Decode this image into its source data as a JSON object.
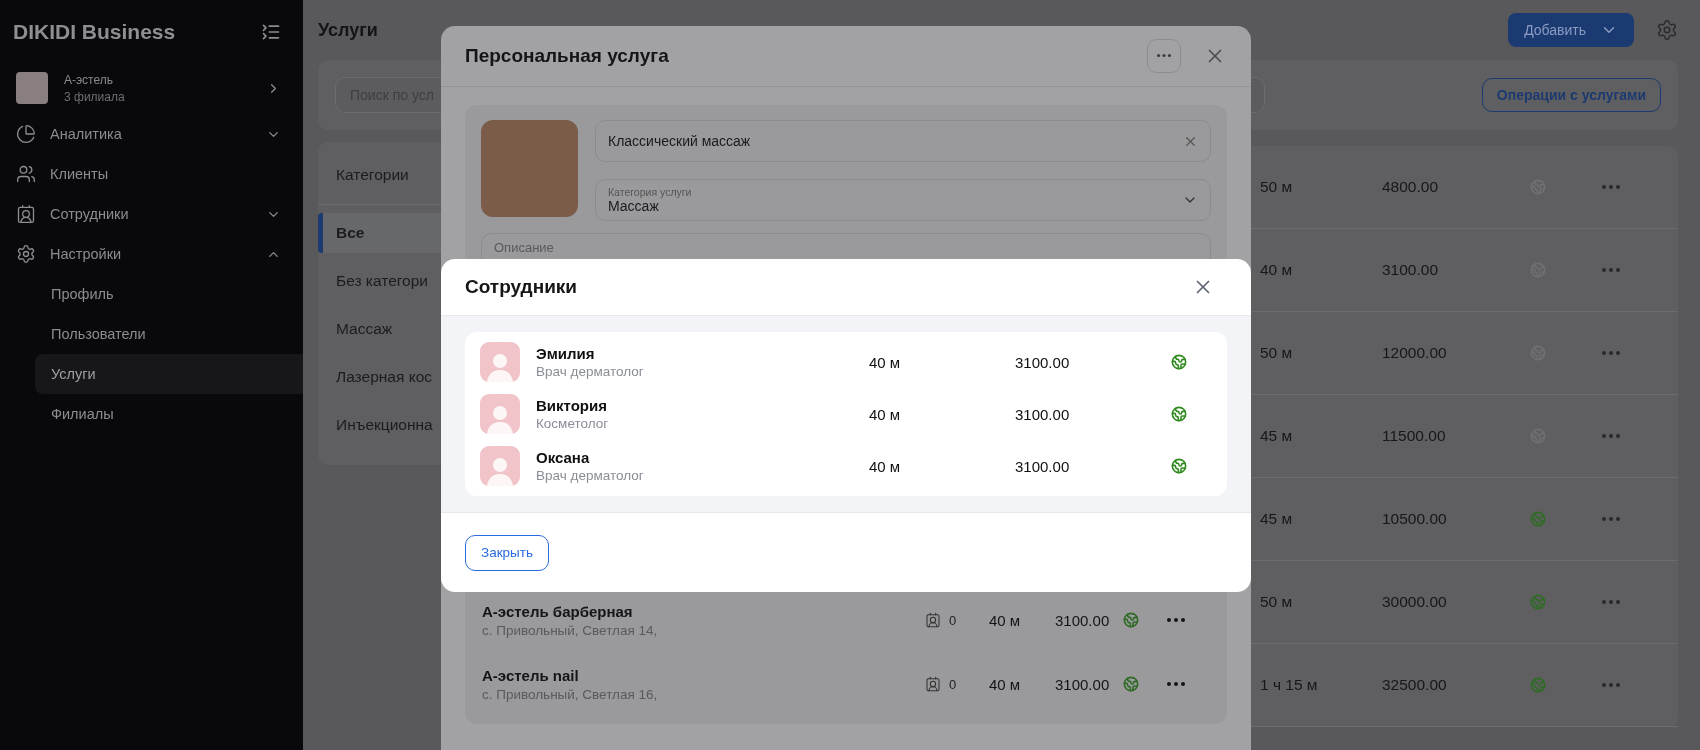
{
  "sidebar": {
    "brand": "DIKIDI Business",
    "account": {
      "name": "А-эстель",
      "subtitle": "3 филиала"
    },
    "items": [
      {
        "label": "Аналитика",
        "kind": "group",
        "expanded": false
      },
      {
        "label": "Клиенты",
        "kind": "link"
      },
      {
        "label": "Сотрудники",
        "kind": "group",
        "expanded": false
      },
      {
        "label": "Настройки",
        "kind": "group",
        "expanded": true,
        "children": [
          {
            "label": "Профиль",
            "selected": false
          },
          {
            "label": "Пользователи",
            "selected": false
          },
          {
            "label": "Услуги",
            "selected": true
          },
          {
            "label": "Филиалы",
            "selected": false
          }
        ]
      }
    ]
  },
  "page": {
    "title": "Услуги",
    "add_button": "Добавить",
    "search": {
      "placeholder": "Поиск по усл"
    },
    "operations_button": "Операции с услугами"
  },
  "categories": {
    "title": "Категории",
    "items": [
      {
        "label": "Все",
        "selected": true
      },
      {
        "label": "Без категори",
        "selected": false
      },
      {
        "label": "Массаж",
        "selected": false
      },
      {
        "label": "Лазерная кос",
        "selected": false
      },
      {
        "label": "Инъекционна",
        "selected": false
      }
    ]
  },
  "services": [
    {
      "duration": "50 м",
      "price": "4800.00",
      "published": false
    },
    {
      "duration": "40 м",
      "price": "3100.00",
      "published": false
    },
    {
      "duration": "50 м",
      "price": "12000.00",
      "published": false
    },
    {
      "duration": "45 м",
      "price": "11500.00",
      "published": false
    },
    {
      "duration": "45 м",
      "price": "10500.00",
      "published": true
    },
    {
      "duration": "50 м",
      "price": "30000.00",
      "published": true
    },
    {
      "duration": "1 ч 15 м",
      "price": "32500.00",
      "published": true
    }
  ],
  "service_dialog": {
    "title": "Персональная услуга",
    "name_value": "Классический массаж",
    "category": {
      "label": "Категория услуги",
      "value": "Массаж"
    },
    "description": {
      "placeholder": "Описание"
    },
    "branches": [
      {
        "name": "А-эстель барберная",
        "address": "с. Привольный, Светлая 14,",
        "employees": "0",
        "duration": "40 м",
        "price": "3100.00",
        "published": true
      },
      {
        "name": "А-эстель nail",
        "address": "с. Привольный, Светлая 16,",
        "employees": "0",
        "duration": "40 м",
        "price": "3100.00",
        "published": true
      }
    ]
  },
  "staff_dialog": {
    "title": "Сотрудники",
    "employees": [
      {
        "name": "Эмилия",
        "role": "Врач дерматолог",
        "duration": "40 м",
        "price": "3100.00",
        "published": true
      },
      {
        "name": "Виктория",
        "role": "Косметолог",
        "duration": "40 м",
        "price": "3100.00",
        "published": true
      },
      {
        "name": "Оксана",
        "role": "Врач дерматолог",
        "duration": "40 м",
        "price": "3100.00",
        "published": true
      }
    ],
    "close_button": "Закрыть"
  }
}
